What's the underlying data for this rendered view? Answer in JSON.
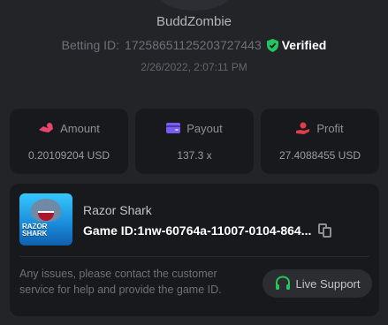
{
  "header": {
    "username": "BuddZombie",
    "betting_id_label": "Betting ID:",
    "betting_id": "17258651125203727443",
    "verified_label": "Verified",
    "timestamp": "2/26/2022, 2:07:11 PM"
  },
  "stats": [
    {
      "label": "Amount",
      "value": "0.20109204 USD",
      "icon": "coins-icon",
      "color": "#e8466d"
    },
    {
      "label": "Payout",
      "value": "137.3 x",
      "icon": "wallet-icon",
      "color": "#7b5cf0"
    },
    {
      "label": "Profit",
      "value": "27.4088455 USD",
      "icon": "hand-coin-icon",
      "color": "#e23b4a"
    }
  ],
  "game": {
    "thumbnail_text": "RAZOR SHARK",
    "name": "Razor Shark",
    "id_label": "Game ID:",
    "id_value": "1nw-60764a-11007-0104-864..."
  },
  "support": {
    "help_text": "Any issues, please contact the customer service for help and provide the game ID.",
    "button_label": "Live Support",
    "button_icon": "headset-icon"
  },
  "colors": {
    "background": "#232428",
    "card": "#18191c",
    "verified": "#22c55e",
    "live_support_icon": "#22c55e"
  }
}
